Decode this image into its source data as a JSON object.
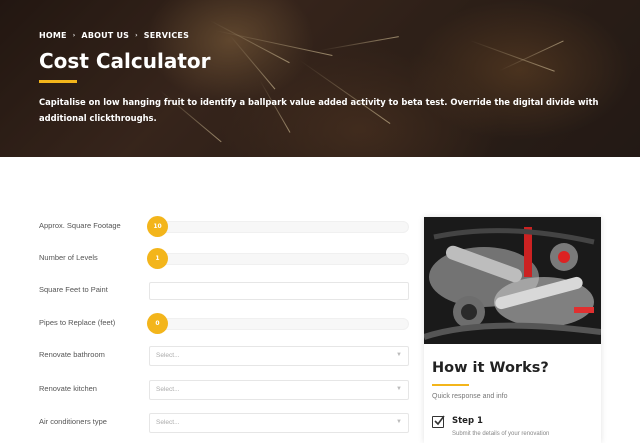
{
  "hero": {
    "breadcrumb": [
      "HOME",
      "ABOUT US",
      "SERVICES"
    ],
    "title": "Cost Calculator",
    "description": "Capitalise on low hanging fruit to identify a ballpark value added activity to beta test. Override the digital divide with additional clickthroughs.",
    "accent_color": "#f3b51b"
  },
  "form": {
    "square_footage": {
      "label": "Approx. Square Footage",
      "value": "10"
    },
    "levels": {
      "label": "Number of Levels",
      "value": "1"
    },
    "paint": {
      "label": "Square Feet to Paint",
      "value": ""
    },
    "pipes": {
      "label": "Pipes to Replace (feet)",
      "value": "0"
    },
    "bathroom": {
      "label": "Renovate bathroom",
      "placeholder": "Select..."
    },
    "kitchen": {
      "label": "Renovate kitchen",
      "placeholder": "Select..."
    },
    "ac": {
      "label": "Air conditioners type",
      "placeholder": "Select..."
    }
  },
  "how_it_works": {
    "title": "How it Works?",
    "subtitle": "Quick response and info",
    "step": {
      "title": "Step 1",
      "description": "Submit the details of your renovation",
      "icon": "checkbox-icon"
    }
  }
}
